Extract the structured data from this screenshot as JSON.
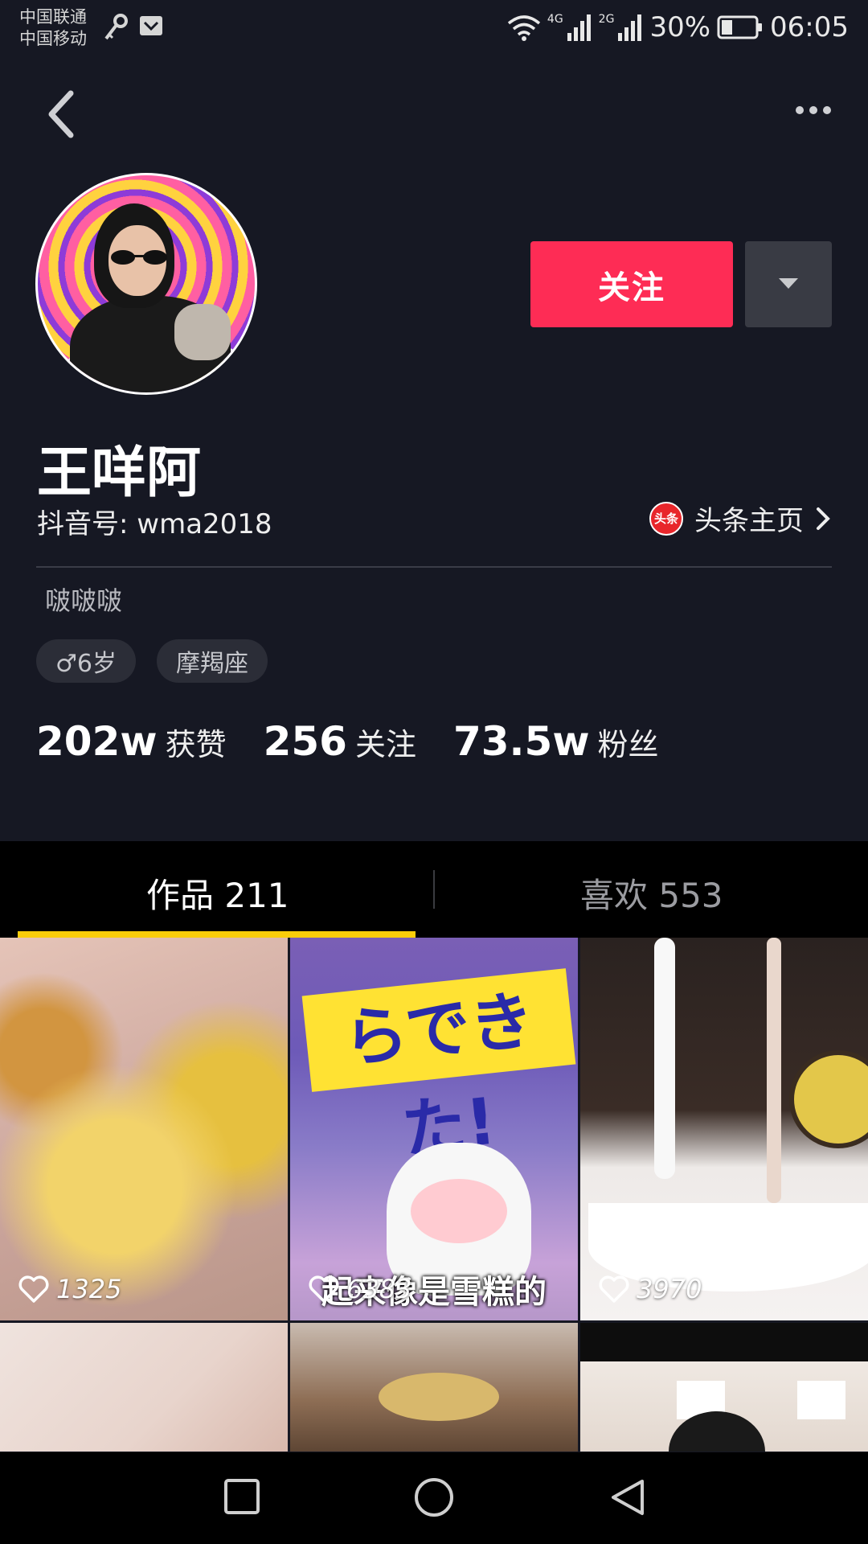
{
  "status_bar": {
    "carrier1": "中国联通",
    "carrier2": "中国移动",
    "net1": "4G",
    "net2": "2G",
    "battery": "30%",
    "time": "06:05"
  },
  "profile": {
    "follow_label": "关注",
    "name": "王咩阿",
    "douyin_id": "抖音号: wma2018",
    "toutiao_logo": "头条",
    "toutiao_label": "头条主页",
    "bio": "啵啵啵",
    "tags": [
      "♂6岁",
      "摩羯座"
    ],
    "stats": [
      {
        "value": "202w",
        "label": "获赞"
      },
      {
        "value": "256",
        "label": "关注"
      },
      {
        "value": "73.5w",
        "label": "粉丝"
      }
    ]
  },
  "tabs": {
    "works": "作品 211",
    "likes": "喜欢 553"
  },
  "videos": [
    {
      "likes": "1325"
    },
    {
      "likes": "6383",
      "caption": "起来像是雪糕的",
      "cover_text": "らできた!"
    },
    {
      "likes": "3970"
    }
  ],
  "colors": {
    "background": "#161823",
    "follow_button": "#fe2c55",
    "tab_indicator": "#facd0a"
  }
}
